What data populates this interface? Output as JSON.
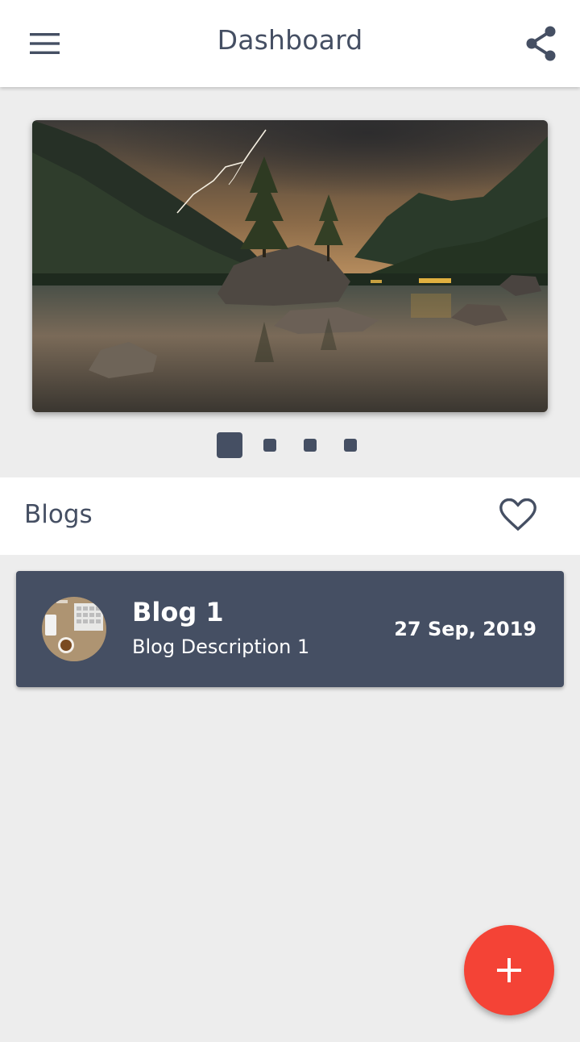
{
  "appbar": {
    "title": "Dashboard",
    "menu_icon": "menu-icon",
    "share_icon": "share-icon"
  },
  "carousel": {
    "slide_count": 4,
    "active_index": 0
  },
  "blogs": {
    "header_label": "Blogs",
    "favorite_icon": "heart-outline-icon",
    "items": [
      {
        "title": "Blog 1",
        "description": "Blog Description 1",
        "date": "27 Sep, 2019"
      }
    ]
  },
  "fab": {
    "icon": "plus-icon"
  },
  "colors": {
    "primary": "#454f63",
    "accent": "#f44336",
    "background": "#ededed",
    "surface": "#ffffff"
  }
}
